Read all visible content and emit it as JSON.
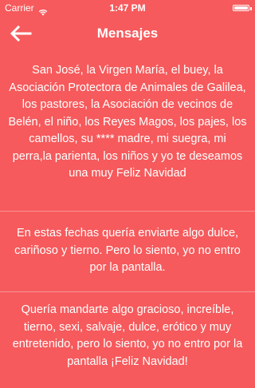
{
  "status_bar": {
    "carrier": "Carrier",
    "time": "1:47 PM",
    "icons": [
      "wifi-icon",
      "battery-icon"
    ]
  },
  "nav": {
    "back_icon": "arrow-left-icon",
    "title": "Mensajes"
  },
  "messages": [
    {
      "text": "San José, la Virgen María, el buey, la Asociación Protectora de Animales de Galilea, los pastores, la Asociación de vecinos de Belén, el niño, los Reyes Magos, los pajes, los camellos, su **** madre, mi suegra, mi perra,la parienta, los niños y yo te deseamos una muy Feliz Navidad"
    },
    {
      "text": "En estas fechas quería enviarte algo dulce, cariñoso y tierno. Pero lo siento, yo no entro por la pantalla."
    },
    {
      "text": "Quería mandarte algo gracioso, increíble, tierno, sexi, salvaje, dulce, erótico y muy entretenido, pero lo siento, yo no entro por la pantalla ¡Feliz Navidad!"
    }
  ],
  "colors": {
    "background": "#f65a5c",
    "text": "#ffffff"
  }
}
